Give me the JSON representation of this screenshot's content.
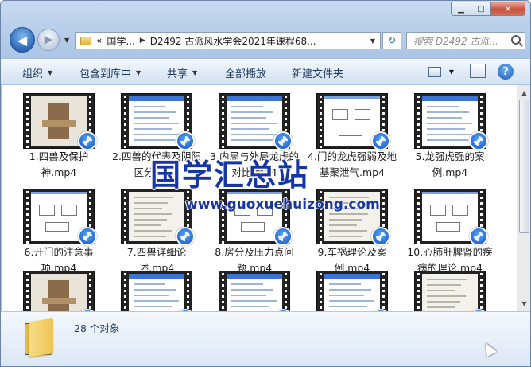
{
  "window": {
    "min_glyph": "▁",
    "max_glyph": "□",
    "close_glyph": "✕"
  },
  "nav": {
    "back_glyph": "◀",
    "forward_glyph": "▶",
    "history_glyph": "▼"
  },
  "address": {
    "lead": "«",
    "crumbs": [
      "国学...",
      "D2492 古派风水学会2021年课程68..."
    ],
    "sep": "▶",
    "dropdown_glyph": "▼"
  },
  "refresh_glyph": "↻",
  "search": {
    "placeholder": "搜索 D2492 古派..."
  },
  "toolbar": {
    "organize": "组织",
    "include": "包含到库中",
    "share": "共享",
    "playall": "全部播放",
    "newfolder": "新建文件夹",
    "caret": "▼",
    "help": "?"
  },
  "files": [
    {
      "name": "1.四兽及保护神.mp4",
      "kind": "pic"
    },
    {
      "name": "2.四兽的代表及阴阳区分.mp4",
      "kind": "doc"
    },
    {
      "name": "3.内局与外局龙虎的对比.mp4",
      "kind": "doc"
    },
    {
      "name": "4.门的龙虎强弱及地基聚泄气.mp4",
      "kind": "sketch"
    },
    {
      "name": "5.龙强虎强的案例.mp4",
      "kind": "doc"
    },
    {
      "name": "6.开门的注意事项.mp4",
      "kind": "sketch"
    },
    {
      "name": "7.四兽详细论述.mp4",
      "kind": "paper"
    },
    {
      "name": "8.房分及压力点问题.mp4",
      "kind": "sketch"
    },
    {
      "name": "9.车祸理论及案例.mp4",
      "kind": "paper"
    },
    {
      "name": "10.心肺肝脾肾的疾病的理论.mp4",
      "kind": "sketch"
    },
    {
      "name": "",
      "kind": "pic"
    },
    {
      "name": "",
      "kind": "doc"
    },
    {
      "name": "",
      "kind": "doc"
    },
    {
      "name": "",
      "kind": "doc"
    },
    {
      "name": "",
      "kind": "paper"
    }
  ],
  "watermark": {
    "title": "国学汇总站",
    "url": "www.guoxuehuizong.com"
  },
  "status": {
    "count": "28 个对象"
  }
}
